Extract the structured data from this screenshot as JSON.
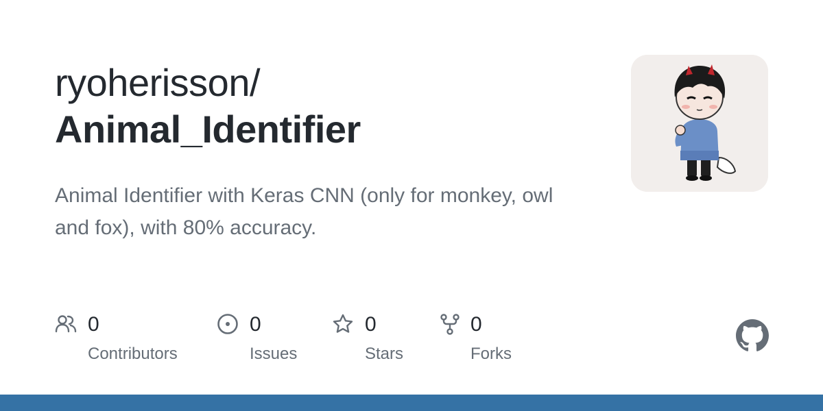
{
  "repo": {
    "owner": "ryoherisson/",
    "name": "Animal_Identifier",
    "description": "Animal Identifier with Keras CNN (only for monkey, owl and fox), with 80% accuracy."
  },
  "stats": [
    {
      "icon": "people-icon",
      "value": "0",
      "label": "Contributors"
    },
    {
      "icon": "issue-icon",
      "value": "0",
      "label": "Issues"
    },
    {
      "icon": "star-icon",
      "value": "0",
      "label": "Stars"
    },
    {
      "icon": "fork-icon",
      "value": "0",
      "label": "Forks"
    }
  ],
  "avatar": {
    "icon": "chibi-avatar"
  },
  "logo": {
    "icon": "github-logo-icon"
  },
  "colors": {
    "title": "#24292f",
    "muted": "#656d76",
    "icon": "#656d76",
    "accent_bar": "#3572a5",
    "avatar_bg": "#f2eeec"
  }
}
